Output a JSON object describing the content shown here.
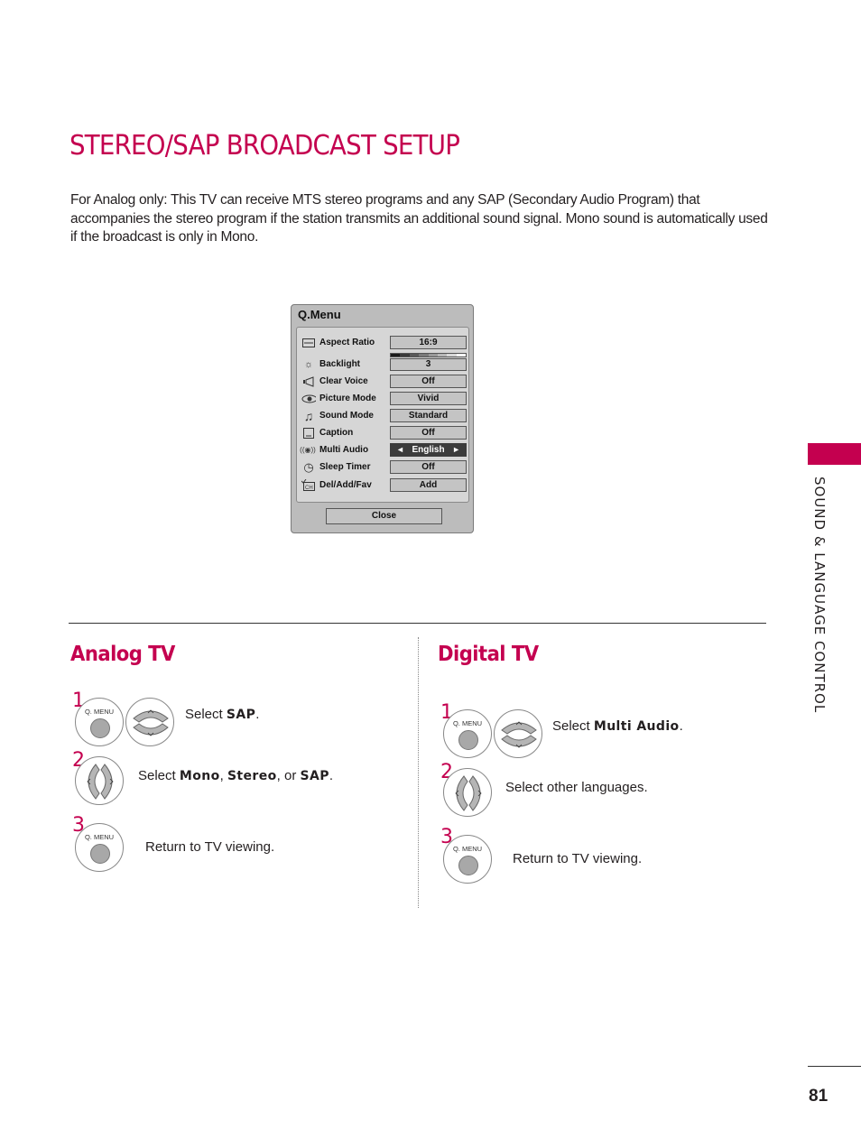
{
  "page": {
    "title": "STEREO/SAP BROADCAST SETUP",
    "intro": "For Analog only: This TV can receive MTS stereo programs and any SAP (Secondary Audio Program) that accompanies the stereo program if the station transmits an additional sound signal. Mono sound is automatically used if the broadcast is only in Mono.",
    "side_label": "SOUND & LANGUAGE CONTROL",
    "page_number": "81",
    "accent_color": "#c4004f"
  },
  "qmenu": {
    "title": "Q.Menu",
    "items": [
      {
        "icon": "aspect-ratio-icon",
        "glyph": "⟷",
        "label": "Aspect Ratio",
        "value": "16:9"
      },
      {
        "icon": "backlight-icon",
        "glyph": "☼",
        "label": "Backlight",
        "value": "3",
        "level": "3 of 8"
      },
      {
        "icon": "clear-voice-icon",
        "glyph": "◁",
        "label": "Clear Voice",
        "value": "Off"
      },
      {
        "icon": "picture-mode-icon",
        "glyph": "◉",
        "label": "Picture Mode",
        "value": "Vivid"
      },
      {
        "icon": "sound-mode-icon",
        "glyph": "♫",
        "label": "Sound Mode",
        "value": "Standard"
      },
      {
        "icon": "caption-icon",
        "glyph": "▭",
        "label": "Caption",
        "value": "Off"
      },
      {
        "icon": "multi-audio-icon",
        "glyph": "((◉))",
        "label": "Multi Audio",
        "value": "English",
        "selected": true
      },
      {
        "icon": "sleep-timer-icon",
        "glyph": "◷",
        "label": "Sleep Timer",
        "value": "Off"
      },
      {
        "icon": "channel-icon",
        "glyph": "CH",
        "label": "Del/Add/Fav",
        "value": "Add"
      }
    ],
    "left_arrow": "◄",
    "right_arrow": "►",
    "close_label": "Close"
  },
  "analog": {
    "title": "Analog TV",
    "steps": [
      {
        "num": "1",
        "button_caption": "Q. MENU",
        "pre": "Select ",
        "bold": "SAP",
        "post": "."
      },
      {
        "num": "2",
        "pre": "Select ",
        "bold1": "Mono",
        "mid1": ", ",
        "bold2": "Stereo",
        "mid2": ", or ",
        "bold3": "SAP",
        "post": "."
      },
      {
        "num": "3",
        "button_caption": "Q. MENU",
        "text": "Return to TV viewing."
      }
    ]
  },
  "digital": {
    "title": "Digital TV",
    "steps": [
      {
        "num": "1",
        "button_caption": "Q. MENU",
        "pre": "Select ",
        "bold": "Multi Audio",
        "post": "."
      },
      {
        "num": "2",
        "text": "Select other languages."
      },
      {
        "num": "3",
        "button_caption": "Q. MENU",
        "text": "Return to TV viewing."
      }
    ]
  }
}
